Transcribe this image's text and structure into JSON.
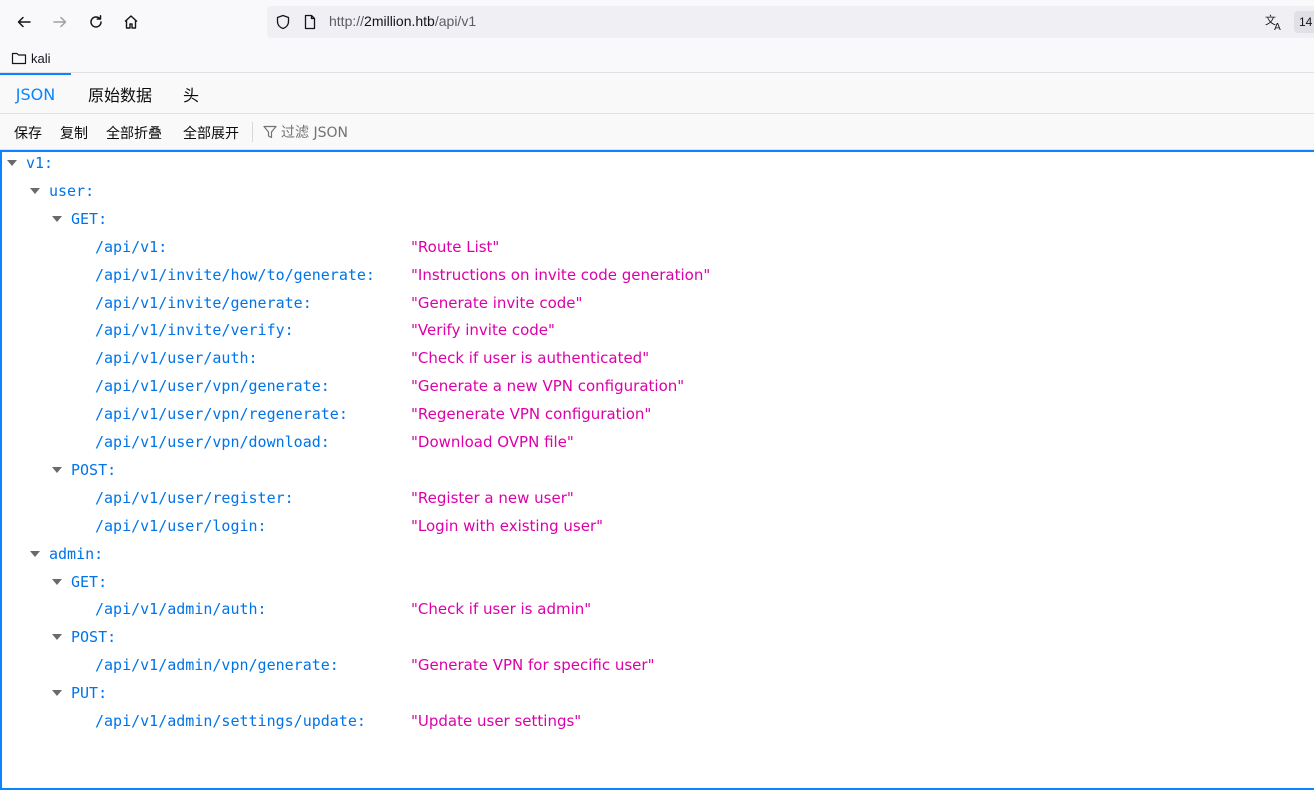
{
  "browser": {
    "url_prefix": "http://",
    "url_host": "2million.htb",
    "url_path": "/api/v1",
    "zoom": "14"
  },
  "bookmarks": [
    {
      "label": "kali"
    }
  ],
  "tabs": [
    {
      "label": "JSON"
    },
    {
      "label": "原始数据"
    },
    {
      "label": "头"
    }
  ],
  "actions": {
    "save": "保存",
    "copy": "复制",
    "collapse_all": "全部折叠",
    "expand_all": "全部展开",
    "filter_placeholder": "过滤 JSON"
  },
  "tree": {
    "root": "v1:",
    "user_key": "user:",
    "user_get_key": "GET:",
    "user_get": [
      {
        "key": "/api/v1:",
        "value": "\"Route List\""
      },
      {
        "key": "/api/v1/invite/how/to/generate:",
        "value": "\"Instructions on invite code generation\""
      },
      {
        "key": "/api/v1/invite/generate:",
        "value": "\"Generate invite code\""
      },
      {
        "key": "/api/v1/invite/verify:",
        "value": "\"Verify invite code\""
      },
      {
        "key": "/api/v1/user/auth:",
        "value": "\"Check if user is authenticated\""
      },
      {
        "key": "/api/v1/user/vpn/generate:",
        "value": "\"Generate a new VPN configuration\""
      },
      {
        "key": "/api/v1/user/vpn/regenerate:",
        "value": "\"Regenerate VPN configuration\""
      },
      {
        "key": "/api/v1/user/vpn/download:",
        "value": "\"Download OVPN file\""
      }
    ],
    "user_post_key": "POST:",
    "user_post": [
      {
        "key": "/api/v1/user/register:",
        "value": "\"Register a new user\""
      },
      {
        "key": "/api/v1/user/login:",
        "value": "\"Login with existing user\""
      }
    ],
    "admin_key": "admin:",
    "admin_get_key": "GET:",
    "admin_get": [
      {
        "key": "/api/v1/admin/auth:",
        "value": "\"Check if user is admin\""
      }
    ],
    "admin_post_key": "POST:",
    "admin_post": [
      {
        "key": "/api/v1/admin/vpn/generate:",
        "value": "\"Generate VPN for specific user\""
      }
    ],
    "admin_put_key": "PUT:",
    "admin_put": [
      {
        "key": "/api/v1/admin/settings/update:",
        "value": "\"Update user settings\""
      }
    ]
  },
  "colors": {
    "key": "#0074e8",
    "string": "#dd00a9",
    "accent": "#0a84ff"
  }
}
